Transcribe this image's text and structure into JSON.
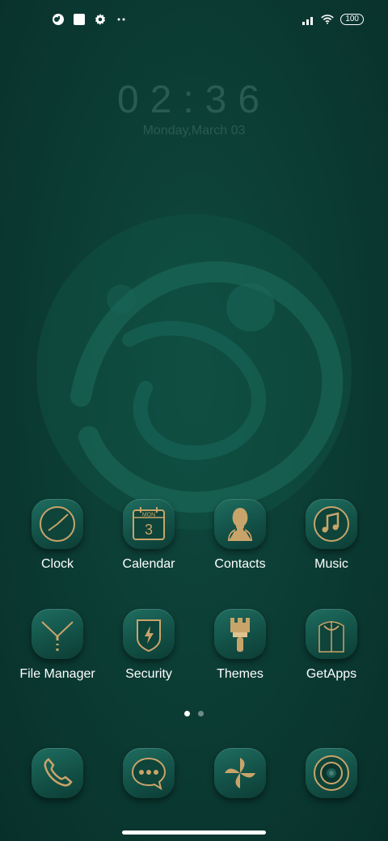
{
  "status_bar": {
    "left_icons": [
      "app-icon",
      "square-icon",
      "gear-icon",
      "more-dots-icon"
    ],
    "battery": "100"
  },
  "lock_clock": {
    "time": "02:36",
    "date": "Monday,March 03"
  },
  "apps_row1": [
    {
      "label": "Clock",
      "icon": "clock-icon"
    },
    {
      "label": "Calendar",
      "icon": "calendar-icon",
      "calendar_day": "MON",
      "calendar_date": "3"
    },
    {
      "label": "Contacts",
      "icon": "contacts-icon"
    },
    {
      "label": "Music",
      "icon": "music-icon"
    }
  ],
  "apps_row2": [
    {
      "label": "File Manager",
      "icon": "file-manager-icon"
    },
    {
      "label": "Security",
      "icon": "security-icon"
    },
    {
      "label": "Themes",
      "icon": "themes-icon"
    },
    {
      "label": "GetApps",
      "icon": "getapps-icon"
    }
  ],
  "dock": [
    {
      "icon": "phone-icon"
    },
    {
      "icon": "messages-icon"
    },
    {
      "icon": "pinwheel-icon"
    },
    {
      "icon": "camera-icon"
    }
  ],
  "page_indicator": {
    "pages": 2,
    "current": 1
  },
  "colors": {
    "background": "#0b3b33",
    "gold": "#c9a46a",
    "icon_bg": "#155a4f"
  }
}
